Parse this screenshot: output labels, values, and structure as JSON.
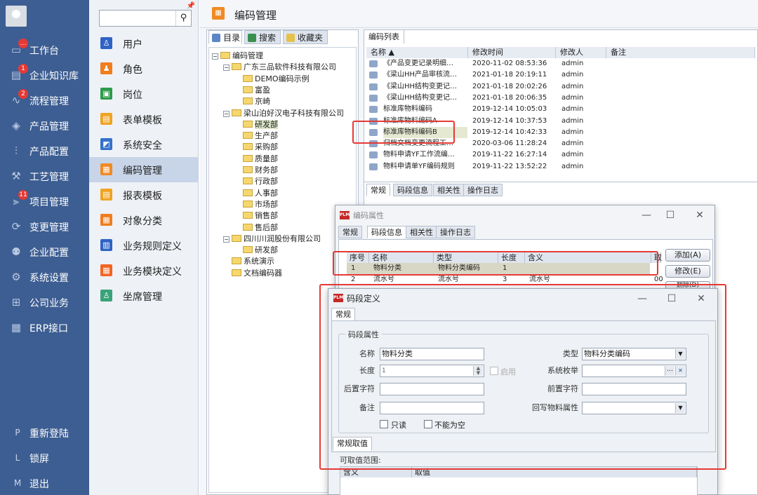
{
  "nav": {
    "items": [
      {
        "label": "工作台",
        "icon": "monitor-icon",
        "badge": "…"
      },
      {
        "label": "企业知识库",
        "icon": "book-icon",
        "badge": "1"
      },
      {
        "label": "流程管理",
        "icon": "flow-icon",
        "badge": "2"
      },
      {
        "label": "产品管理",
        "icon": "cube-icon",
        "badge": ""
      },
      {
        "label": "产品配置",
        "icon": "sliders-icon",
        "badge": ""
      },
      {
        "label": "工艺管理",
        "icon": "wrench-icon",
        "badge": ""
      },
      {
        "label": "项目管理",
        "icon": "project-icon",
        "badge": "11"
      },
      {
        "label": "变更管理",
        "icon": "change-icon",
        "badge": ""
      },
      {
        "label": "企业配置",
        "icon": "users-icon",
        "badge": ""
      },
      {
        "label": "系统设置",
        "icon": "gear-icon",
        "badge": ""
      },
      {
        "label": "公司业务",
        "icon": "grid-icon",
        "badge": ""
      },
      {
        "label": "ERP接口",
        "icon": "apps-icon",
        "badge": ""
      }
    ],
    "bottom": [
      {
        "key": "P",
        "label": "重新登陆"
      },
      {
        "key": "L",
        "label": "锁屏"
      },
      {
        "key": "M",
        "label": "退出"
      }
    ]
  },
  "sidebar": {
    "search_placeholder": "",
    "items": [
      {
        "label": "用户",
        "color": "#2f63c4",
        "glyph": "♙"
      },
      {
        "label": "角色",
        "color": "#f07d1e",
        "glyph": "♟"
      },
      {
        "label": "岗位",
        "color": "#2e9a4b",
        "glyph": "▣"
      },
      {
        "label": "表单模板",
        "color": "#f0a423",
        "glyph": "▤"
      },
      {
        "label": "系统安全",
        "color": "#3472c9",
        "glyph": "◩"
      },
      {
        "label": "编码管理",
        "color": "#f08a24",
        "glyph": "▦"
      },
      {
        "label": "报表模板",
        "color": "#f0a423",
        "glyph": "▤"
      },
      {
        "label": "对象分类",
        "color": "#f07d1e",
        "glyph": "▦"
      },
      {
        "label": "业务规则定义",
        "color": "#2f63c4",
        "glyph": "▥"
      },
      {
        "label": "业务模块定义",
        "color": "#f26522",
        "glyph": "▦"
      },
      {
        "label": "坐席管理",
        "color": "#3aa37a",
        "glyph": "♙"
      }
    ],
    "active_index": 5
  },
  "main": {
    "title": "编码管理",
    "tree_tabs": [
      "目录",
      "搜索",
      "收藏夹"
    ],
    "tree": [
      {
        "label": "编码管理",
        "level": 0,
        "toggle": "⊟"
      },
      {
        "label": "广东三品软件科技有限公司",
        "level": 1,
        "toggle": "⊟"
      },
      {
        "label": "DEMO编码示例",
        "level": 2,
        "toggle": ""
      },
      {
        "label": "富盈",
        "level": 2,
        "toggle": ""
      },
      {
        "label": "京崎",
        "level": 2,
        "toggle": ""
      },
      {
        "label": "梁山泊好汉电子科技有限公司",
        "level": 1,
        "toggle": "⊟"
      },
      {
        "label": "研发部",
        "level": 2,
        "toggle": "",
        "selected": true
      },
      {
        "label": "生产部",
        "level": 2,
        "toggle": ""
      },
      {
        "label": "采购部",
        "level": 2,
        "toggle": ""
      },
      {
        "label": "质量部",
        "level": 2,
        "toggle": ""
      },
      {
        "label": "财务部",
        "level": 2,
        "toggle": ""
      },
      {
        "label": "行政部",
        "level": 2,
        "toggle": ""
      },
      {
        "label": "人事部",
        "level": 2,
        "toggle": ""
      },
      {
        "label": "市场部",
        "level": 2,
        "toggle": ""
      },
      {
        "label": "销售部",
        "level": 2,
        "toggle": ""
      },
      {
        "label": "售后部",
        "level": 2,
        "toggle": ""
      },
      {
        "label": "四川川润股份有限公司",
        "level": 1,
        "toggle": "⊟"
      },
      {
        "label": "研发部",
        "level": 2,
        "toggle": ""
      },
      {
        "label": "系统演示",
        "level": 1,
        "toggle": ""
      },
      {
        "label": "文档编码器",
        "level": 1,
        "toggle": ""
      }
    ],
    "list_tab": "编码列表",
    "list_headers": [
      "名称 ▲",
      "修改时间",
      "修改人",
      "备注"
    ],
    "list_rows": [
      {
        "name": "《产品变更记录明细…",
        "time": "2020-11-02 08:53:36",
        "by": "admin"
      },
      {
        "name": "《梁山HH产品审核流…",
        "time": "2021-01-18 20:19:11",
        "by": "admin"
      },
      {
        "name": "《梁山HH结构变更记…",
        "time": "2021-01-18 20:02:26",
        "by": "admin"
      },
      {
        "name": "《梁山HH结构变更记…",
        "time": "2021-01-18 20:06:35",
        "by": "admin"
      },
      {
        "name": "标准库物料编码",
        "time": "2019-12-14 10:05:03",
        "by": "admin"
      },
      {
        "name": "标准库物料编码A",
        "time": "2019-12-14 10:37:53",
        "by": "admin"
      },
      {
        "name": "标准库物料编码B",
        "time": "2019-12-14 10:42:33",
        "by": "admin",
        "highlight": true
      },
      {
        "name": "归档文档变更流程工…",
        "time": "2020-03-06 11:28:24",
        "by": "admin"
      },
      {
        "name": "物料申请YF工作流编…",
        "time": "2019-11-22 16:27:14",
        "by": "admin"
      },
      {
        "name": "物料申请单YF编码规则",
        "time": "2019-11-22 13:52:22",
        "by": "admin"
      }
    ],
    "bottom_tabs": [
      "常规",
      "码段信息",
      "相关性",
      "操作日志"
    ]
  },
  "dialog_props": {
    "logo": "PLM",
    "title": "编码属性",
    "tabs": [
      "常规",
      "码段信息",
      "相关性",
      "操作日志"
    ],
    "headers": [
      "序号",
      "名称",
      "类型",
      "长度",
      "含义",
      "取"
    ],
    "rows": [
      {
        "seq": "1",
        "name": "物料分类",
        "type": "物料分类编码",
        "len": "1",
        "meaning": "",
        "extra": ""
      },
      {
        "seq": "2",
        "name": "流水号",
        "type": "流水号",
        "len": "3",
        "meaning": "流水号",
        "extra": "00"
      }
    ],
    "btn_add": "添加(A)",
    "btn_edit": "修改(E)",
    "btn_del": "删除(D)"
  },
  "dialog_seg": {
    "logo": "PLM",
    "title": "码段定义",
    "tab": "常规",
    "group": "码段属性",
    "name_label": "名称",
    "name_value": "物料分类",
    "type_label": "类型",
    "type_value": "物料分类编码",
    "len_label": "长度",
    "len_value": "1",
    "enable_label": "启用",
    "enum_label": "系统枚举",
    "enum_value": "",
    "suffix_label": "后置字符",
    "suffix_value": "",
    "prefix_label": "前置字符",
    "prefix_value": "",
    "remark_label": "备注",
    "remark_value": "",
    "writeback_label": "回写物料属性",
    "writeback_value": "",
    "readonly_label": "只读",
    "notnull_label": "不能为空",
    "subtab": "常规取值",
    "range_label": "可取值范围:",
    "range_headers": [
      "含义",
      "取值"
    ]
  }
}
